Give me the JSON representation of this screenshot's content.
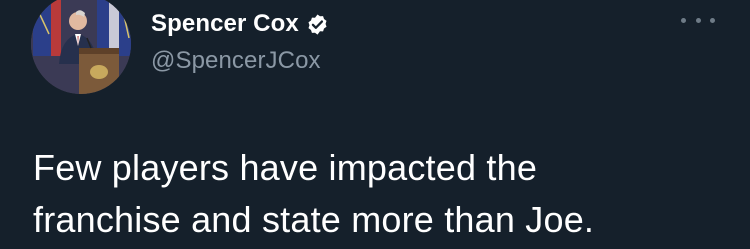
{
  "tweet": {
    "author": {
      "display_name": "Spencer Cox",
      "handle": "@SpencerJCox",
      "verified": true
    },
    "more_icon": "more-horizontal-icon",
    "text_lines": [
      "Few players have impacted the",
      "franchise and state more than Joe."
    ]
  },
  "colors": {
    "background": "#15202b",
    "text_primary": "#ffffff",
    "text_secondary": "#8b98a5",
    "verified_badge": "#ffffff"
  }
}
